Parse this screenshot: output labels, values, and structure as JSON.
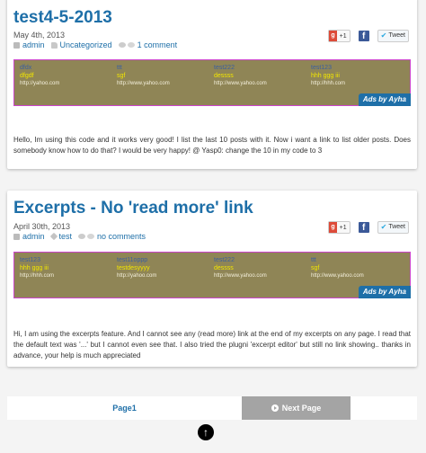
{
  "posts": [
    {
      "title": "test4-5-2013",
      "date": "May 4th, 2013",
      "author": "admin",
      "category": "Uncategorized",
      "comments": "1 comment",
      "share": {
        "gplus": "+1",
        "facebook": "f",
        "tweet": "Tweet"
      },
      "ads": [
        {
          "name": "dfdx",
          "desc": "dfgdf",
          "url": "http://yahoo.com"
        },
        {
          "name": "ttt",
          "desc": "sgf",
          "url": "http://www.yahoo.com"
        },
        {
          "name": "test222",
          "desc": "dessss",
          "url": "http://www.yahoo.com"
        },
        {
          "name": "test123",
          "desc": "hhh ggg iii",
          "url": "http://hhh.com"
        }
      ],
      "ads_by": "Ads by Ayha",
      "body": "Hello, Im using this code and it works very good! I list the last 10 posts with it. Now i want a link to list older posts. Does somebody know how to do that? I would be very happy! @ Yasp0: change the 10 in my code to 3"
    },
    {
      "title": "Excerpts - No 'read more' link",
      "date": "April 30th, 2013",
      "author": "admin",
      "category": "test",
      "comments": "no comments",
      "share": {
        "gplus": "+1",
        "facebook": "f",
        "tweet": "Tweet"
      },
      "ads": [
        {
          "name": "test123",
          "desc": "hhh ggg iii",
          "url": "http://hhh.com"
        },
        {
          "name": "test11oppp",
          "desc": "testdesyyyy",
          "url": "http://yahoo.com"
        },
        {
          "name": "test222",
          "desc": "dessss",
          "url": "http://www.yahoo.com"
        },
        {
          "name": "ttt",
          "desc": "sgf",
          "url": "http://www.yahoo.com"
        }
      ],
      "ads_by": "Ads by Ayha",
      "body": "Hi, I am using the excerpts feature. And I cannot see any (read more) link at the end of my excerpts on any page. I read that the default text was '...' but I cannot even see that. I also tried the plugni 'excerpt editor' but still no link showing.. thanks in advance, your help is much appreciated"
    }
  ],
  "pager": {
    "current": "Page1",
    "next": "Next Page"
  },
  "to_top": "↑",
  "icons": [
    "user-icon",
    "folder-icon",
    "comment-icon",
    "tag-icon",
    "next-arrow-icon",
    "back-to-top-icon"
  ],
  "colors": {
    "link": "#1e6fa8",
    "ad_bg": "#8f8556",
    "ad_border": "#cc44cc",
    "next_bg": "#a4a4a4"
  }
}
